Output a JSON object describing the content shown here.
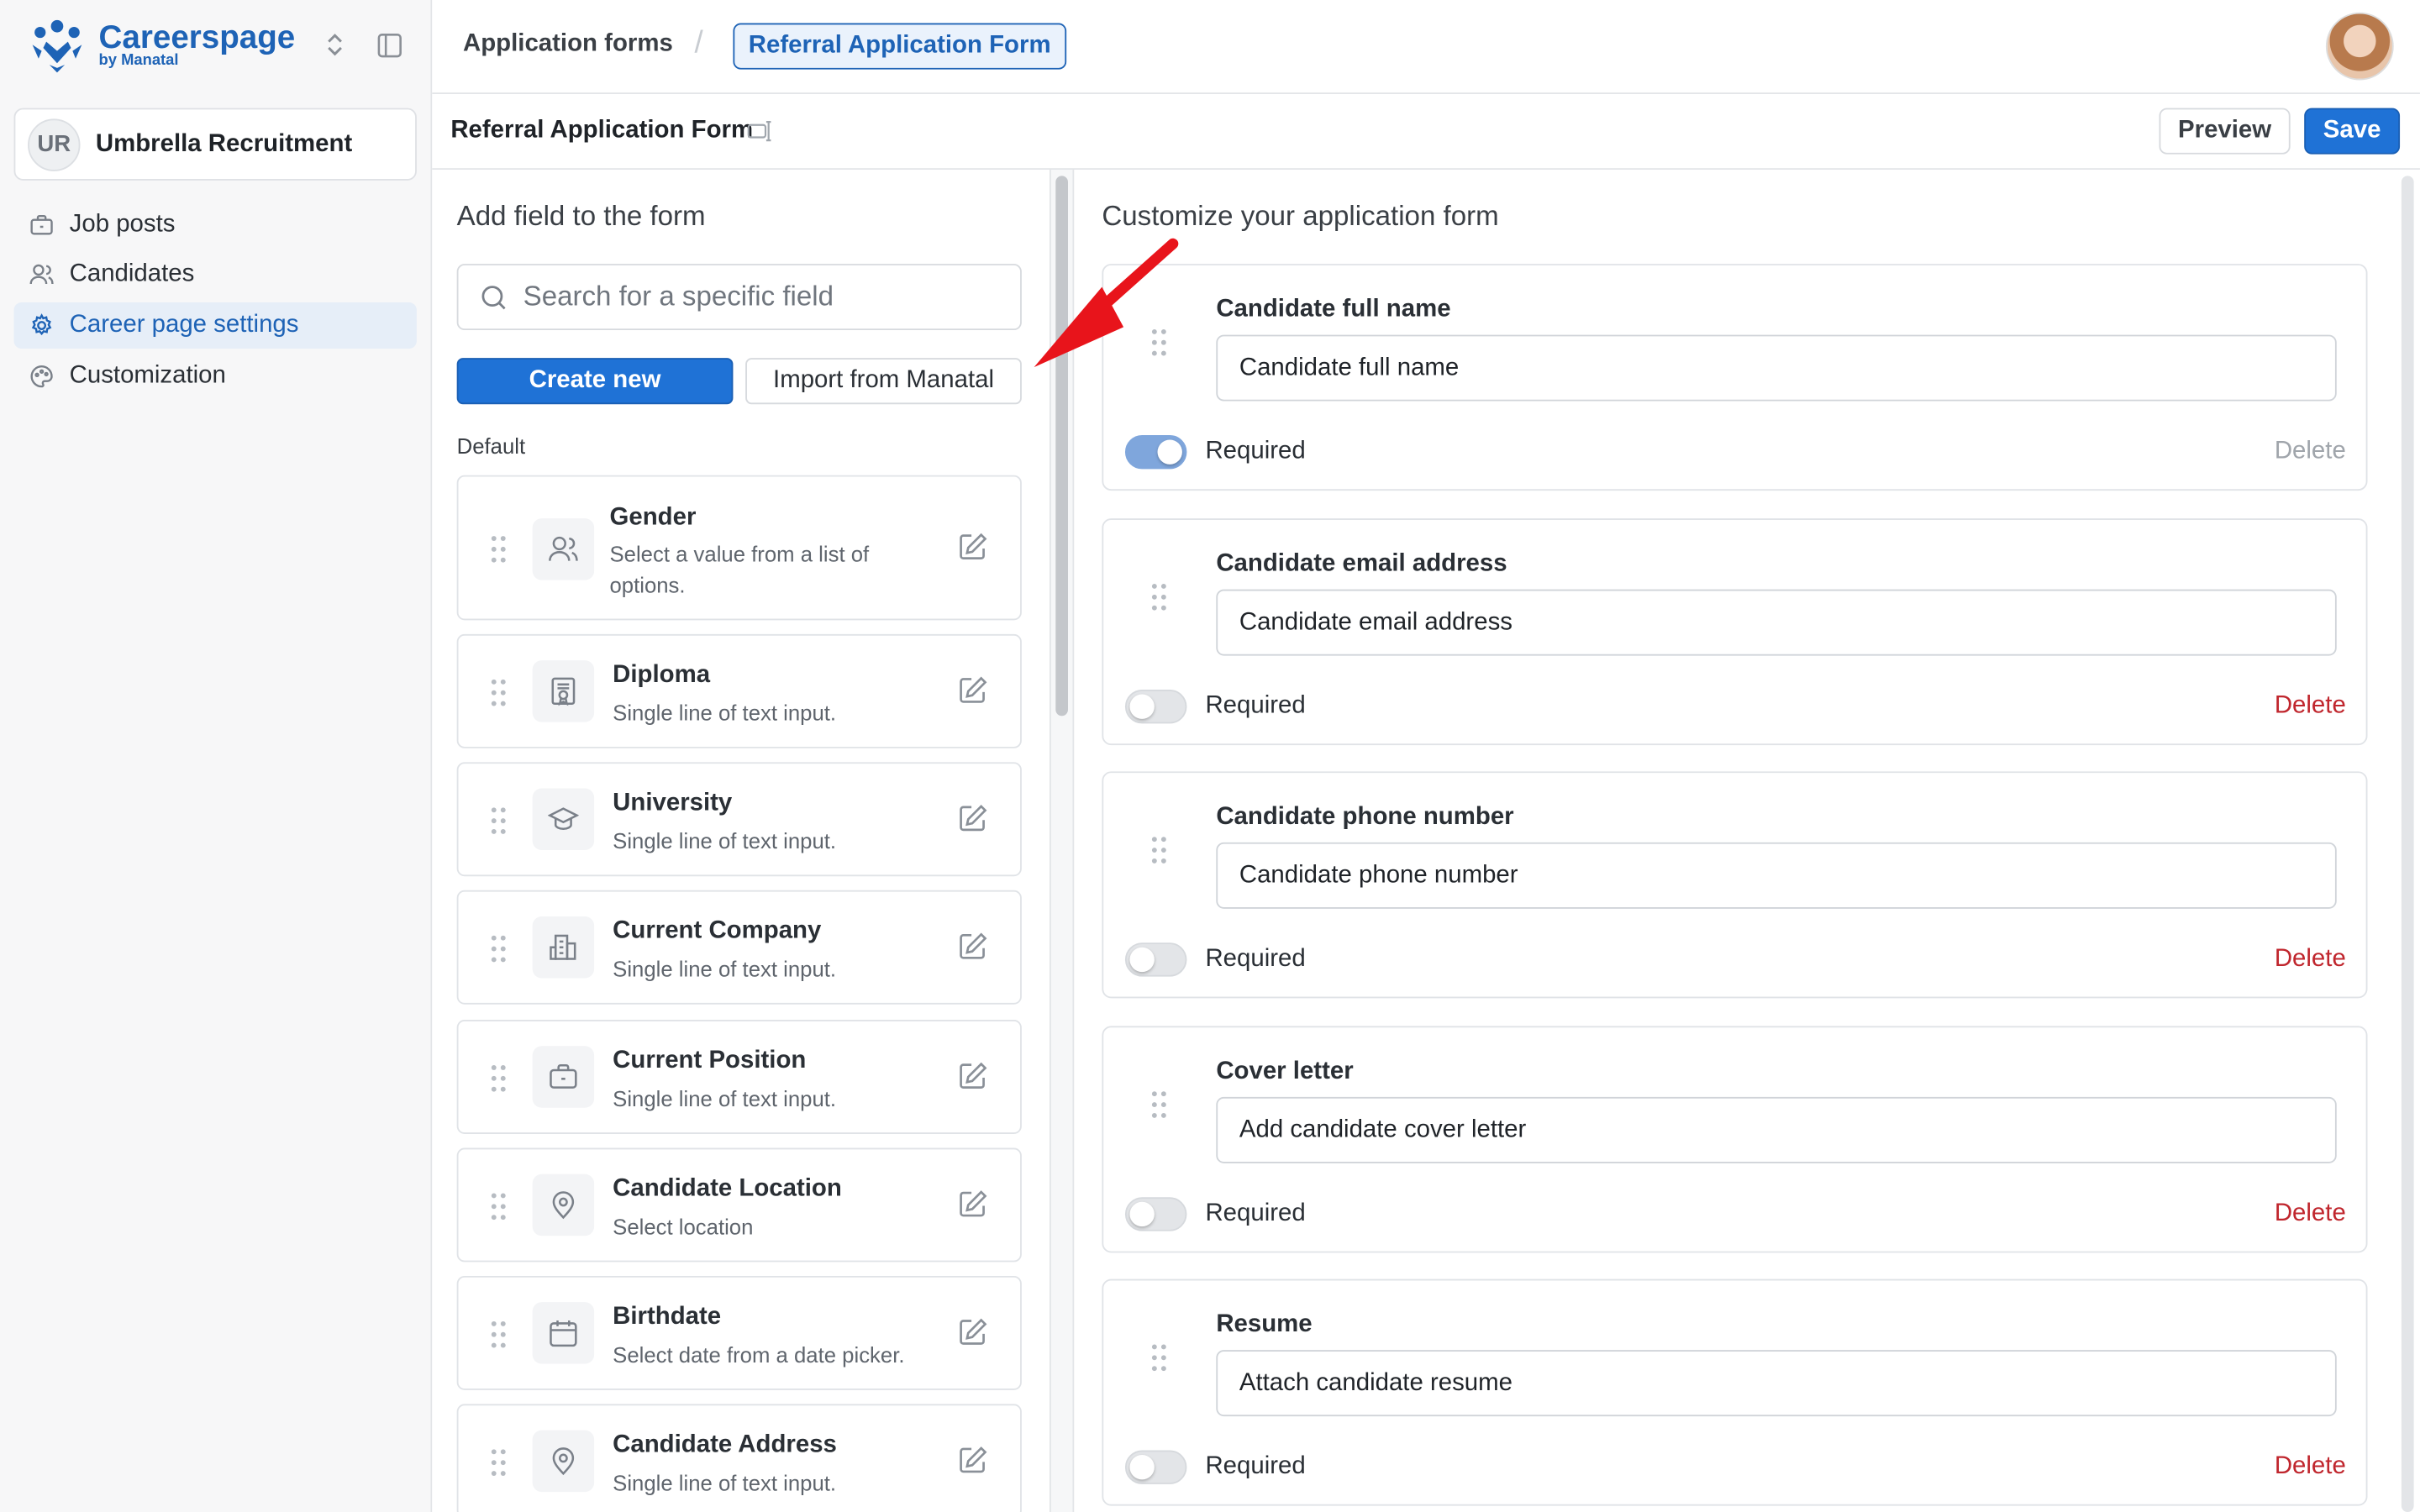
{
  "brand": {
    "name": "Careerspage",
    "sub": "by Manatal"
  },
  "org": {
    "initials": "UR",
    "name": "Umbrella Recruitment"
  },
  "nav": [
    {
      "label": "Job posts",
      "icon": "briefcase-icon"
    },
    {
      "label": "Candidates",
      "icon": "users-icon"
    },
    {
      "label": "Career page settings",
      "icon": "gear-icon"
    },
    {
      "label": "Customization",
      "icon": "palette-icon"
    }
  ],
  "breadcrumb": {
    "parent": "Application forms",
    "current": "Referral Application Form"
  },
  "form": {
    "title": "Referral Application Form",
    "preview_label": "Preview",
    "save_label": "Save"
  },
  "left": {
    "title": "Add field to the form",
    "search_placeholder": "Search for a specific field",
    "create_label": "Create new",
    "import_label": "Import from Manatal",
    "section_label": "Default",
    "fields": [
      {
        "name": "Gender",
        "desc": "Select a value from a list of options.",
        "icon": "users-icon"
      },
      {
        "name": "Diploma",
        "desc": "Single line of text input.",
        "icon": "certificate-icon"
      },
      {
        "name": "University",
        "desc": "Single line of text input.",
        "icon": "graduation-cap-icon"
      },
      {
        "name": "Current Company",
        "desc": "Single line of text input.",
        "icon": "building-icon"
      },
      {
        "name": "Current Position",
        "desc": "Single line of text input.",
        "icon": "briefcase-icon"
      },
      {
        "name": "Candidate Location",
        "desc": "Select location",
        "icon": "map-pin-icon"
      },
      {
        "name": "Birthdate",
        "desc": "Select date from a date picker.",
        "icon": "calendar-icon"
      },
      {
        "name": "Candidate Address",
        "desc": "Single line of text input.",
        "icon": "map-pin-icon"
      }
    ]
  },
  "right": {
    "title": "Customize your application form",
    "required_label": "Required",
    "delete_label": "Delete",
    "fields": [
      {
        "label": "Candidate full name",
        "value": "Candidate full name",
        "required": true,
        "deletable": false
      },
      {
        "label": "Candidate email address",
        "value": "Candidate email address",
        "required": false,
        "deletable": true
      },
      {
        "label": "Candidate phone number",
        "value": "Candidate phone number",
        "required": false,
        "deletable": true
      },
      {
        "label": "Cover letter",
        "value": "Add candidate cover letter",
        "required": false,
        "deletable": true
      },
      {
        "label": "Resume",
        "value": "Attach candidate resume",
        "required": false,
        "deletable": true
      }
    ]
  },
  "colors": {
    "accent": "#1f72d6",
    "brand": "#1e63b6",
    "danger": "#c0262d",
    "annotation_arrow": "#e8141b"
  }
}
